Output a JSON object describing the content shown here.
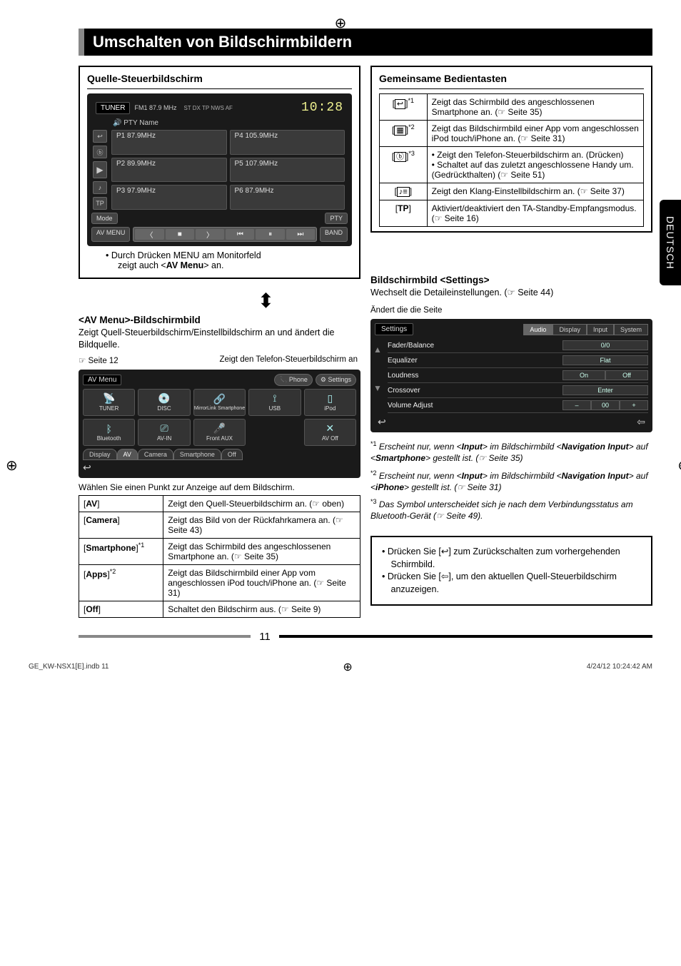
{
  "side_tab": "DEUTSCH",
  "title": "Umschalten von Bildschirmbildern",
  "left": {
    "panel1_title": "Quelle-Steuerbildschirm",
    "tuner": {
      "label": "TUNER",
      "sub": "FM1  87.9 MHz",
      "flags": "ST  DX  TP  NWS  AF",
      "time": "10:28",
      "pty": "PTY Name",
      "presets": [
        "P1  87.9MHz",
        "P4  105.9MHz",
        "P2  89.9MHz",
        "P5  107.9MHz",
        "P3  97.9MHz",
        "P6  87.9MHz"
      ],
      "mode_btn": "Mode",
      "avmenu_btn": "AV MENU",
      "band_btn": "BAND",
      "pty_btn": "PTY"
    },
    "note1_a": "Durch Drücken MENU am Monitorfeld",
    "note1_b_prefix": "zeigt auch <",
    "note1_b_bold": "AV Menu",
    "note1_b_suffix": "> an.",
    "avmenu_heading_prefix": "<AV Menu>",
    "avmenu_heading_suffix": "-Bildschirmbild",
    "avmenu_desc": "Zeigt Quell-Steuerbildschirm/Einstellbildschirm an und ändert die Bildquelle.",
    "callout_left": "☞ Seite 12",
    "callout_right": "Zeigt den Telefon-Steuerbildschirm an",
    "av": {
      "label": "AV Menu",
      "phone_btn": "Phone",
      "settings_btn": "Settings",
      "cells": [
        "TUNER",
        "DISC",
        "MirrorLink Smartphone",
        "USB",
        "iPod",
        "Bluetooth",
        "AV-IN",
        "Front AUX",
        "",
        "AV Off"
      ],
      "tabs": [
        "Display",
        "AV",
        "Camera",
        "Smartphone",
        "Off"
      ]
    },
    "table_caption": "Wählen Sie einen Punkt zur Anzeige auf dem Bildschirm.",
    "deftable": [
      {
        "k": "[AV]",
        "k_bold": "AV",
        "v": "Zeigt den Quell-Steuerbildschirm an. (☞ oben)"
      },
      {
        "k": "[Camera]",
        "k_bold": "Camera",
        "v": "Zeigt das Bild von der Rückfahrkamera an. (☞ Seite 43)"
      },
      {
        "k": "[Smartphone]*1",
        "k_bold": "Smartphone",
        "sup": "*1",
        "v": "Zeigt das Schirmbild des angeschlossenen Smartphone an. (☞ Seite 35)"
      },
      {
        "k": "[Apps]*2",
        "k_bold": "Apps",
        "sup": "*2",
        "v": "Zeigt das Bildschirmbild einer App vom angeschlossen iPod touch/iPhone an. (☞ Seite 31)"
      },
      {
        "k": "[Off]",
        "k_bold": "Off",
        "v": "Schaltet den Bildschirm aus. (☞ Seite 9)"
      }
    ]
  },
  "right": {
    "panel_title": "Gemeinsame Bedientasten",
    "rows": [
      {
        "icon": "↩",
        "sup": "*1",
        "text": "Zeigt das Schirmbild des angeschlossenen Smartphone an. (☞ Seite 35)"
      },
      {
        "icon": "▦",
        "sup": "*2",
        "text": "Zeigt das Bildschirmbild einer App vom angeschlossen iPod touch/iPhone an. (☞ Seite 31)"
      },
      {
        "icon": "ⓑ",
        "sup": "*3",
        "text_list": [
          "Zeigt den Telefon-Steuerbildschirm an. (Drücken)",
          "Schaltet auf das zuletzt angeschlossene Handy um. (Gedrückthalten) (☞ Seite 51)"
        ]
      },
      {
        "icon": "♪≡",
        "text": "Zeigt den Klang-Einstellbildschirm an. (☞ Seite 37)"
      },
      {
        "icon": "TP",
        "bold": true,
        "text": "Aktiviert/deaktiviert den TA-Standby-Empfangsmodus. (☞ Seite 16)"
      }
    ],
    "settings_heading_prefix": "Bildschirmbild <",
    "settings_heading_bold": "Settings",
    "settings_heading_suffix": ">",
    "settings_desc": "Wechselt die Detaileinstellungen. (☞ Seite 44)",
    "settings_callout": "Ändert die die Seite",
    "settings": {
      "title": "Settings",
      "tabs": [
        "Audio",
        "Display",
        "Input",
        "System"
      ],
      "rows": [
        {
          "label": "Fader/Balance",
          "val": "0/0"
        },
        {
          "label": "Equalizer",
          "val": "Flat"
        },
        {
          "label": "Loudness",
          "split": [
            "On",
            "Off"
          ]
        },
        {
          "label": "Crossover",
          "val": "Enter"
        },
        {
          "label": "Volume Adjust",
          "triple": [
            "–",
            "00",
            "+"
          ]
        }
      ]
    },
    "footnotes": [
      {
        "n": "*1",
        "pre": "Erscheint nur, wenn <",
        "b1": "Input",
        "mid1": "> im Bildschirmbild <",
        "b2": "Navigation Input",
        "mid2": "> auf <",
        "b3": "Smartphone",
        "post": "> gestellt ist. (☞ Seite 35)"
      },
      {
        "n": "*2",
        "pre": "Erscheint nur, wenn <",
        "b1": "Input",
        "mid1": "> im Bildschirmbild <",
        "b2": "Navigation Input",
        "mid2": "> auf <",
        "b3": "iPhone",
        "post": "> gestellt ist. (☞ Seite 31)"
      },
      {
        "n": "*3",
        "plain": "Das Symbol unterscheidet sich je nach dem Verbindungsstatus am Bluetooth-Gerät (☞ Seite 49)."
      }
    ],
    "bullets": [
      "Drücken Sie [↩] zum Zurückschalten zum vorhergehenden Schirmbild.",
      "Drücken Sie [⇦], um den aktuellen Quell-Steuerbildschirm anzuzeigen."
    ]
  },
  "page_number": "11",
  "footer_left": "GE_KW-NSX1[E].indb   11",
  "footer_right": "4/24/12   10:24:42 AM"
}
